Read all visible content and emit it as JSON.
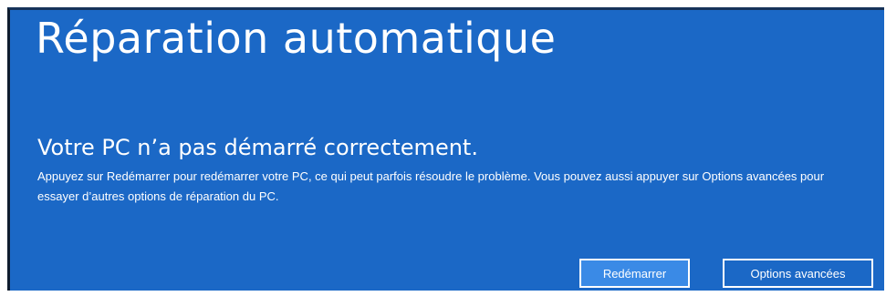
{
  "window": {
    "title": "Réparation automatique"
  },
  "main": {
    "heading": "Votre PC n’a pas démarré correctement.",
    "message": "Appuyez sur Redémarrer pour redémarrer votre PC, ce qui peut parfois résoudre le problème. Vous pouvez aussi appuyer sur Options avancées pour essayer d’autres options de réparation du PC."
  },
  "buttons": {
    "restart_label": "Redémarrer",
    "advanced_label": "Options avancées"
  },
  "colors": {
    "background": "#1b68c6",
    "primary_button": "#3a8ae6",
    "text": "#ffffff"
  }
}
